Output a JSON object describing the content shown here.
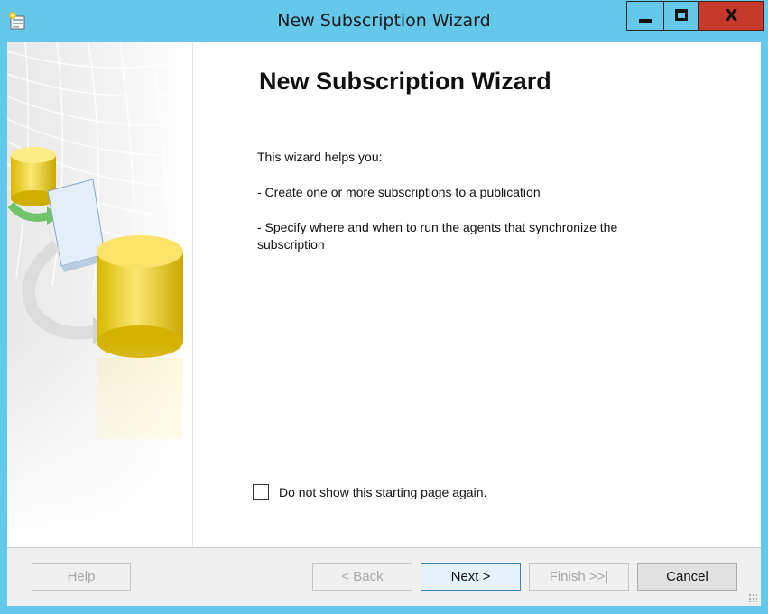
{
  "window": {
    "title": "New Subscription Wizard",
    "accent_color": "#64c8ea",
    "close_color": "#c7392b",
    "controls": {
      "minimize_icon": "minimize-icon",
      "maximize_icon": "maximize-icon",
      "close_label": "X"
    },
    "app_icon": "wizard-app-icon"
  },
  "side_panel": {
    "illustration": "database-replication-illustration"
  },
  "content": {
    "heading": "New Subscription Wizard",
    "intro": "This wizard helps you:",
    "bullets": [
      "- Create one or more subscriptions to a publication",
      "- Specify where and when to run the agents that synchronize the subscription"
    ]
  },
  "options": {
    "dont_show_label": "Do not show this starting page again.",
    "dont_show_checked": false
  },
  "footer": {
    "help_label": "Help",
    "back_label": "< Back",
    "next_label": "Next >",
    "finish_label": "Finish >>|",
    "cancel_label": "Cancel"
  }
}
